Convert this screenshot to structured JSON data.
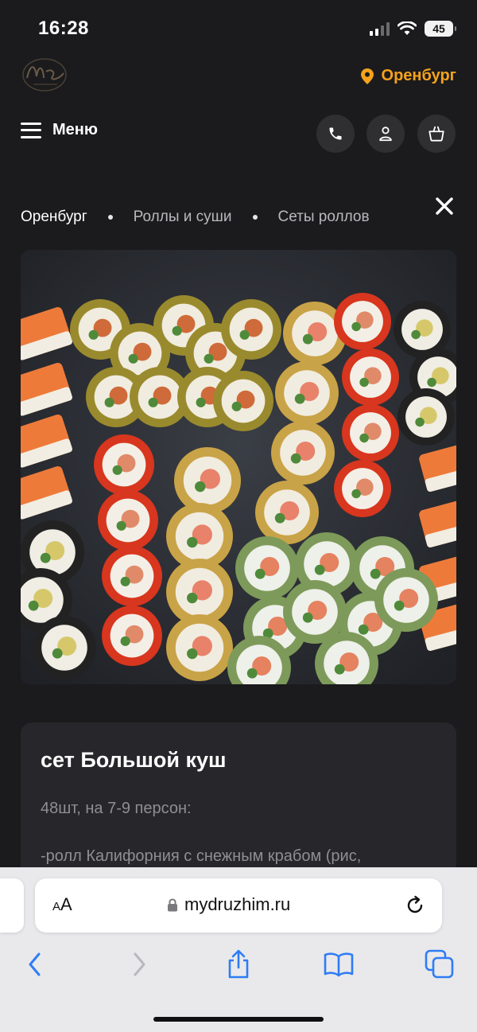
{
  "status": {
    "time": "16:28",
    "battery": "45"
  },
  "header": {
    "city": "Оренбург",
    "menu_label": "Меню"
  },
  "breadcrumbs": [
    "Оренбург",
    "Роллы и суши",
    "Сеты роллов"
  ],
  "product": {
    "title": "сет Большой куш",
    "portion": "48шт, на 7-9 персон:",
    "description_line": "-ролл Калифорния с снежным крабом (рис,"
  },
  "browser": {
    "aa_label_small": "A",
    "aa_label_large": "A",
    "url": "mydruzhim.ru"
  },
  "colors": {
    "accent": "#f5a21b",
    "background": "#1b1b1d",
    "card": "#26262b"
  },
  "icons": [
    "location-pin-icon",
    "phone-icon",
    "user-icon",
    "cart-icon",
    "close-icon",
    "lock-icon",
    "reload-icon",
    "back-icon",
    "forward-icon",
    "share-icon",
    "bookmarks-icon",
    "tabs-icon"
  ]
}
